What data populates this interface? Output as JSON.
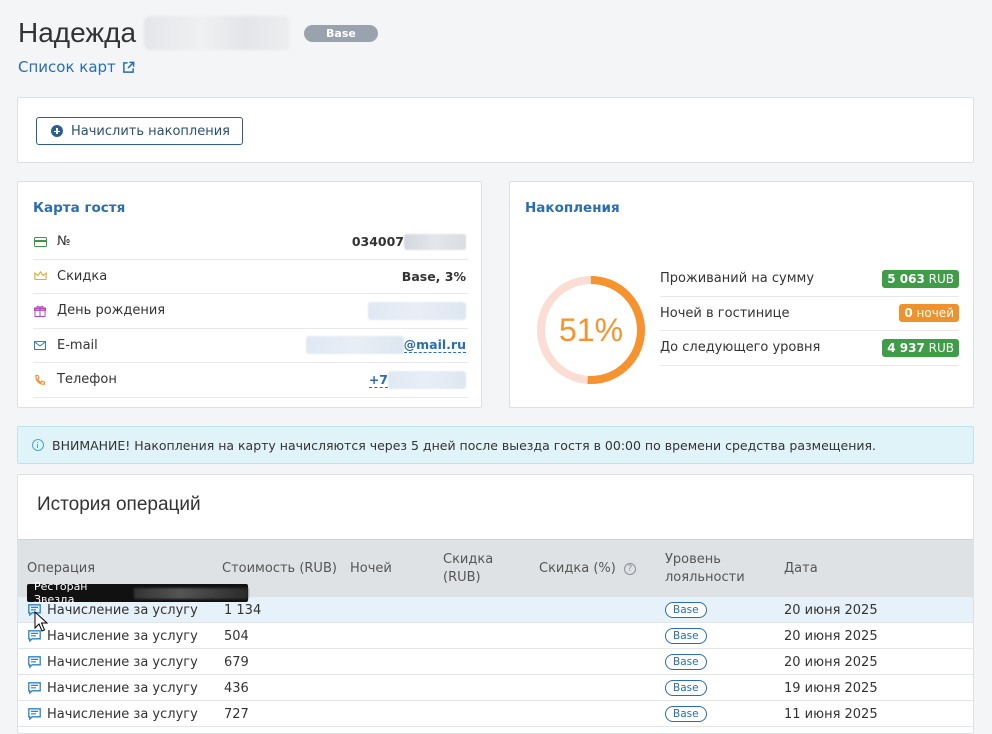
{
  "header": {
    "guest_first_name": "Надежда",
    "level_badge": "Base",
    "cards_link": "Список карт"
  },
  "actions": {
    "accrue_button": "Начислить накопления"
  },
  "guest_card": {
    "title": "Карта гостя",
    "rows": [
      {
        "label": "№",
        "value": "034007",
        "icon": "card-icon"
      },
      {
        "label": "Скидка",
        "value": "Base, 3%",
        "icon": "crown-icon"
      },
      {
        "label": "День рождения",
        "value": "",
        "icon": "gift-icon"
      },
      {
        "label": "E-mail",
        "value": "@mail.ru",
        "icon": "mail-icon"
      },
      {
        "label": "Телефон",
        "value": "+7",
        "icon": "phone-icon"
      }
    ]
  },
  "accumulation": {
    "title": "Накопления",
    "progress_percent": 51,
    "progress_label": "51%",
    "rows": [
      {
        "label": "Проживаний на сумму",
        "amount": "5 063",
        "unit": "RUB",
        "color": "#3f9c47"
      },
      {
        "label": "Ночей в гостинице",
        "amount": "0",
        "unit": "ночей",
        "color": "#f0922b"
      },
      {
        "label": "До следующего уровня",
        "amount": "4 937",
        "unit": "RUB",
        "color": "#3f9c47"
      }
    ]
  },
  "notice": {
    "text": "ВНИМАНИЕ! Накопления на карту начисляются через 5 дней после выезда гостя в 00:00 по времени средства размещения."
  },
  "history": {
    "title": "История операций",
    "columns": {
      "operation": "Операция",
      "cost": "Стоимость (RUB)",
      "nights": "Ночей",
      "discount_rub_1": "Скидка",
      "discount_rub_2": "(RUB)",
      "discount_pct": "Скидка (%)",
      "loyalty_1": "Уровень",
      "loyalty_2": "лояльности",
      "date": "Дата"
    },
    "rows": [
      {
        "operation": "Начисление за услугу",
        "cost": "1 134",
        "level": "Base",
        "date": "20 июня 2025"
      },
      {
        "operation": "Начисление за услугу",
        "cost": "504",
        "level": "Base",
        "date": "20 июня 2025"
      },
      {
        "operation": "Начисление за услугу",
        "cost": "679",
        "level": "Base",
        "date": "20 июня 2025"
      },
      {
        "operation": "Начисление за услугу",
        "cost": "436",
        "level": "Base",
        "date": "19 июня 2025"
      },
      {
        "operation": "Начисление за услугу",
        "cost": "727",
        "level": "Base",
        "date": "11 июня 2025"
      }
    ]
  },
  "tooltip": {
    "text": "Ресторан Звезда"
  },
  "colors": {
    "accent_blue": "#2a6db0",
    "donut_orange": "#f7932f",
    "donut_track": "#fbddd3",
    "green": "#3f9c47",
    "orange": "#f0922b"
  }
}
